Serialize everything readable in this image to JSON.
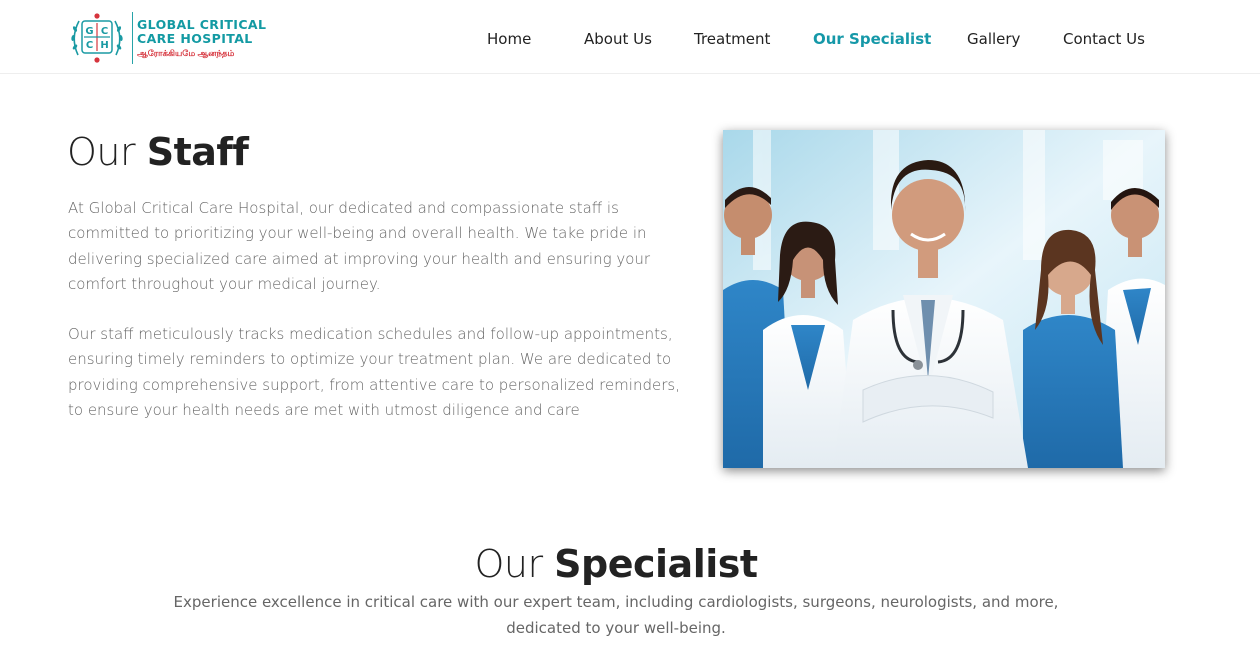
{
  "logo": {
    "emblem_letters": [
      "G",
      "C",
      "C",
      "H"
    ],
    "line1": "GLOBAL CRITICAL",
    "line2": "CARE HOSPITAL",
    "tagline": "ஆரோக்கியமே ஆனந்தம்",
    "icon": "hospital-emblem-icon"
  },
  "nav": {
    "items": [
      {
        "label": "Home",
        "active": false
      },
      {
        "label": "About Us",
        "active": false
      },
      {
        "label": "Treatment",
        "active": false
      },
      {
        "label": "Our Specialist",
        "active": true
      },
      {
        "label": "Gallery",
        "active": false
      },
      {
        "label": "Contact Us",
        "active": false
      }
    ]
  },
  "staff": {
    "title_light": "Our ",
    "title_bold": "Staff",
    "paragraph1": "At Global Critical Care Hospital, our dedicated and compassionate staff is committed to prioritizing your well-being and overall health. We take pride in delivering specialized care aimed at improving your health and ensuring your comfort throughout your medical journey.",
    "paragraph2": "Our staff meticulously tracks medication schedules and follow-up appointments, ensuring timely reminders to optimize your treatment plan. We are dedicated to providing comprehensive support, from attentive care to personalized reminders, to ensure your health needs are met with utmost diligence and care"
  },
  "specialist": {
    "title_light": "Our ",
    "title_bold": "Specialist",
    "description": "Experience excellence in critical care with our expert team, including cardiologists, surgeons, neurologists, and more, dedicated to your well-being."
  },
  "colors": {
    "brand_teal": "#139aa3",
    "nav_active": "#1598a8",
    "tagline_red": "#d6343d"
  }
}
